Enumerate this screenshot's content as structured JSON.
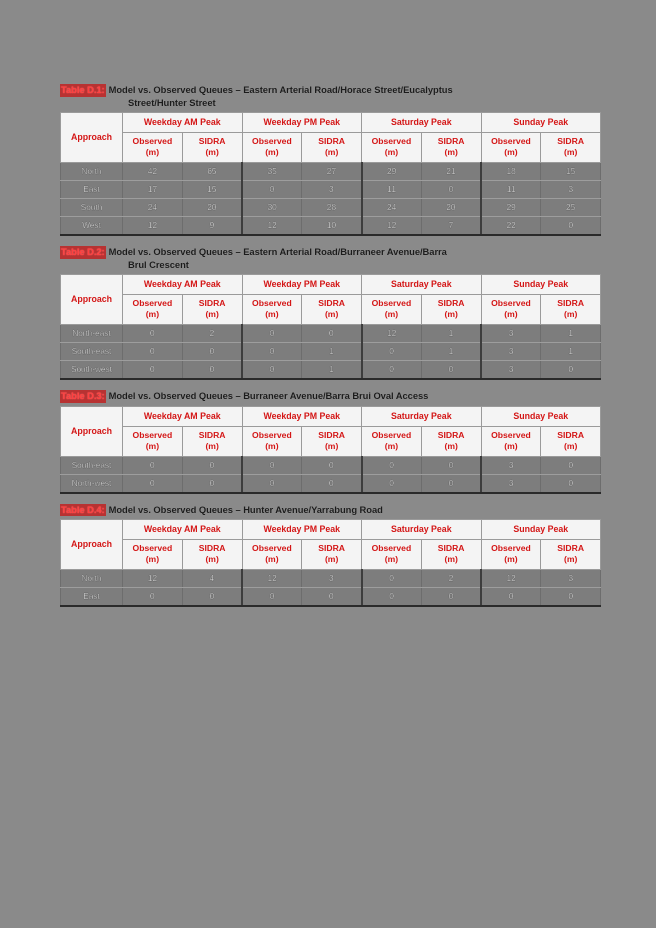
{
  "page": {
    "background_color": "#8a8a8a",
    "document_color": "#8a8a8a"
  },
  "colors": {
    "caption_tag_red": "#ff3a3a",
    "header_red": "#d41616",
    "header_bg": "#f4f4f4",
    "cell_bg": "#7d7d7d",
    "cell_text": "#f2f2f2"
  },
  "common": {
    "approach_header": "Approach",
    "group_headers": [
      "Weekday AM Peak",
      "Weekday PM Peak",
      "Saturday Peak",
      "Sunday Peak"
    ],
    "sub_headers": [
      "Observed",
      "SIDRA",
      "Observed",
      "SIDRA",
      "Observed",
      "SIDRA",
      "Observed",
      "SIDRA"
    ],
    "unit": "(m)"
  },
  "tables": [
    {
      "tag": "Table D.1:",
      "caption_line1": "Model vs. Observed Queues – Eastern Arterial Road/Horace Street/Eucalyptus",
      "caption_line2": "Street/Hunter Street",
      "rows": [
        {
          "approach": "North",
          "values": [
            "42",
            "65",
            "35",
            "27",
            "29",
            "21",
            "18",
            "15"
          ]
        },
        {
          "approach": "East",
          "values": [
            "17",
            "15",
            "0",
            "3",
            "11",
            "0",
            "11",
            "3"
          ]
        },
        {
          "approach": "South",
          "values": [
            "24",
            "20",
            "30",
            "28",
            "24",
            "20",
            "29",
            "25"
          ]
        },
        {
          "approach": "West",
          "values": [
            "12",
            "9",
            "12",
            "10",
            "12",
            "7",
            "22",
            "0"
          ]
        }
      ]
    },
    {
      "tag": "Table D.2:",
      "caption_line1": "Model vs. Observed Queues – Eastern Arterial Road/Burraneer Avenue/Barra",
      "caption_line2": "Brul Crescent",
      "rows": [
        {
          "approach": "North-east",
          "values": [
            "0",
            "2",
            "0",
            "0",
            "12",
            "1",
            "3",
            "1"
          ]
        },
        {
          "approach": "South-east",
          "values": [
            "0",
            "0",
            "0",
            "1",
            "0",
            "1",
            "3",
            "1"
          ]
        },
        {
          "approach": "South-west",
          "values": [
            "0",
            "0",
            "0",
            "1",
            "0",
            "0",
            "3",
            "0"
          ]
        }
      ]
    },
    {
      "tag": "Table D.3:",
      "caption_line1": "Model vs. Observed Queues – Burraneer Avenue/Barra Brui Oval Access",
      "caption_line2": "",
      "rows": [
        {
          "approach": "South-east",
          "values": [
            "0",
            "0",
            "0",
            "0",
            "0",
            "0",
            "3",
            "0"
          ]
        },
        {
          "approach": "North-west",
          "values": [
            "0",
            "0",
            "0",
            "0",
            "0",
            "0",
            "3",
            "0"
          ]
        }
      ]
    },
    {
      "tag": "Table D.4:",
      "caption_line1": "Model vs. Observed Queues – Hunter Avenue/Yarrabung Road",
      "caption_line2": "",
      "rows": [
        {
          "approach": "North",
          "values": [
            "12",
            "4",
            "12",
            "3",
            "0",
            "2",
            "12",
            "3"
          ]
        },
        {
          "approach": "East",
          "values": [
            "0",
            "0",
            "0",
            "0",
            "0",
            "0",
            "0",
            "0"
          ]
        }
      ]
    }
  ]
}
